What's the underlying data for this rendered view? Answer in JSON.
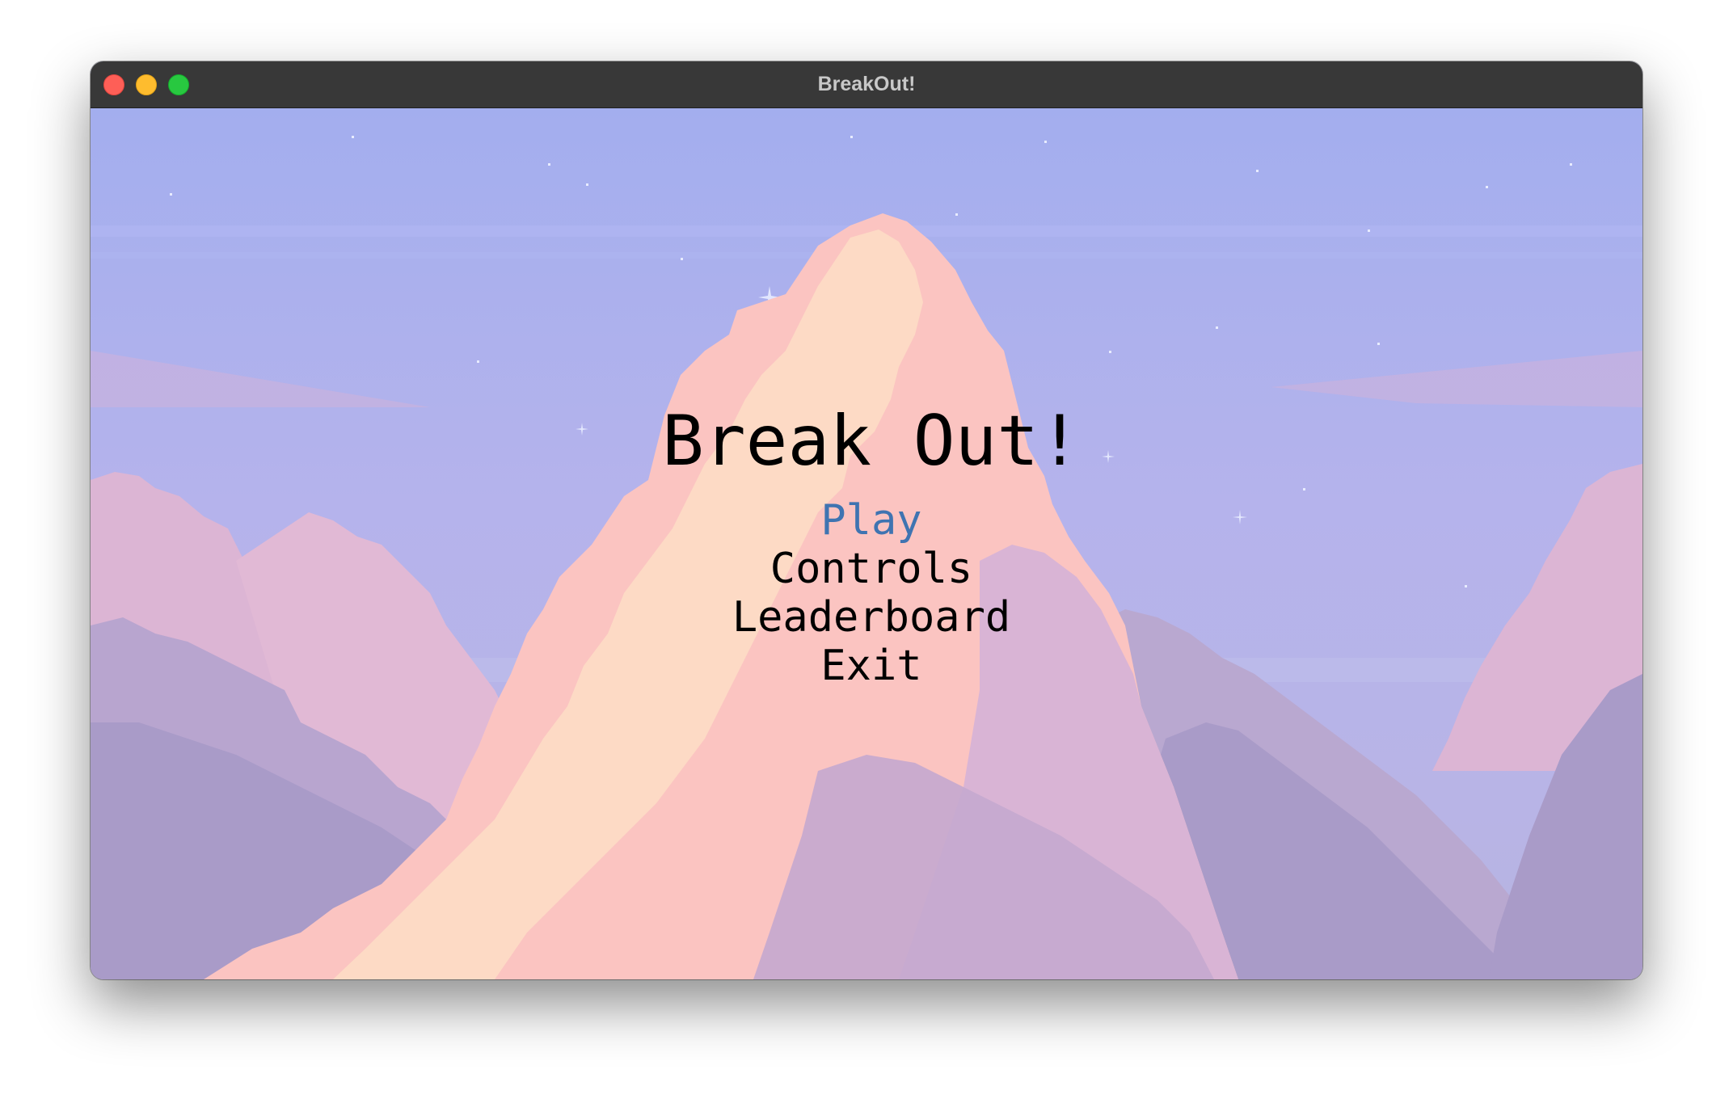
{
  "window": {
    "title": "BreakOut!",
    "traffic_lights": [
      {
        "name": "close",
        "color": "#fe5f57"
      },
      {
        "name": "minimize",
        "color": "#febc2e"
      },
      {
        "name": "zoom",
        "color": "#28c840"
      }
    ]
  },
  "game": {
    "title": "Break Out!",
    "menu": {
      "items": [
        {
          "label": "Play",
          "selected": true
        },
        {
          "label": "Controls",
          "selected": false
        },
        {
          "label": "Leaderboard",
          "selected": false
        },
        {
          "label": "Exit",
          "selected": false
        }
      ],
      "selected_color": "#3f74b1",
      "default_color": "#000000"
    },
    "background": {
      "sky_top": "#a4afee",
      "sky_bottom": "#b7b2ea",
      "cloud_peach": "#fdd8c4",
      "cloud_pink": "#fbc2c0",
      "cloud_lavender": "#d9b5d6",
      "cloud_shadow": "#a99bc8"
    }
  }
}
